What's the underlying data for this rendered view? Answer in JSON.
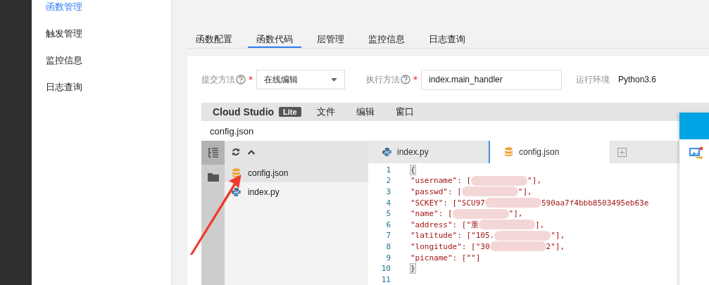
{
  "sidebar": {
    "items": [
      {
        "label": "函数管理",
        "selected": true
      },
      {
        "label": "触发管理",
        "selected": false
      },
      {
        "label": "监控信息",
        "selected": false
      },
      {
        "label": "日志查询",
        "selected": false
      }
    ]
  },
  "tabs": [
    {
      "label": "函数配置",
      "selected": false
    },
    {
      "label": "函数代码",
      "selected": true
    },
    {
      "label": "层管理",
      "selected": false
    },
    {
      "label": "监控信息",
      "selected": false
    },
    {
      "label": "日志查询",
      "selected": false
    }
  ],
  "form": {
    "submit_method": {
      "label": "提交方法",
      "required": true,
      "value": "在线编辑"
    },
    "handler": {
      "label": "执行方法",
      "required": true,
      "value": "index.main_handler"
    },
    "runtime": {
      "label": "运行环境",
      "value": "Python3.6"
    }
  },
  "studio": {
    "brand": "Cloud Studio",
    "badge": "Lite",
    "menu": [
      "文件",
      "编辑",
      "窗口"
    ],
    "file_title": "config.json",
    "files": [
      {
        "name": "config.json",
        "kind": "json",
        "selected": true
      },
      {
        "name": "index.py",
        "kind": "python",
        "selected": false
      }
    ],
    "editor_tabs": [
      {
        "name": "index.py",
        "kind": "python",
        "selected": false
      },
      {
        "name": "config.json",
        "kind": "json",
        "selected": true
      }
    ],
    "lines": [
      {
        "number": "1",
        "before": "{"
      },
      {
        "number": "2",
        "before": "\"username\": [",
        "redacted": true,
        "after": "\"],"
      },
      {
        "number": "3",
        "before": "\"passwd\": [",
        "redacted": true,
        "after": "\"],"
      },
      {
        "number": "4",
        "before": "\"SCKEY\": [\"SCU97",
        "redacted": true,
        "after": "590aa7f4bbb8503495eb63e"
      },
      {
        "number": "5",
        "before": "\"name\": [",
        "redacted": true,
        "after": "\"],"
      },
      {
        "number": "6",
        "before": "\"address\": [\"重",
        "redacted": true,
        "after": "],"
      },
      {
        "number": "7",
        "before": "\"latitude\": [\"105.",
        "redacted": true,
        "after": "\"],"
      },
      {
        "number": "8",
        "before": "\"longitude\": [\"30",
        "redacted": true,
        "after": "2\"],"
      },
      {
        "number": "9",
        "before": "\"picname\": [\"\"]"
      },
      {
        "number": "10",
        "before": "}"
      },
      {
        "number": "11"
      }
    ]
  }
}
